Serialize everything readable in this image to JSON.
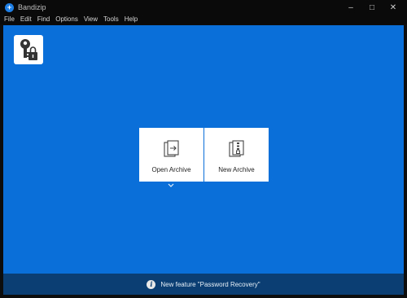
{
  "window": {
    "title": "Bandizip",
    "controls": {
      "minimize": "–",
      "maximize": "□",
      "close": "✕"
    }
  },
  "menu": {
    "items": [
      "File",
      "Edit",
      "Find",
      "Options",
      "View",
      "Tools",
      "Help"
    ]
  },
  "main": {
    "tiles": {
      "open_label": "Open Archive",
      "new_label": "New Archive"
    },
    "password_tool_icon": "key-lock-icon",
    "expand_icon": "chevron-down-icon"
  },
  "bottom": {
    "message": "New feature \"Password Recovery\""
  },
  "colors": {
    "main_blue": "#0a6fd8",
    "bottom_bar": "#0b3f73",
    "chrome": "#0a0a0a"
  }
}
